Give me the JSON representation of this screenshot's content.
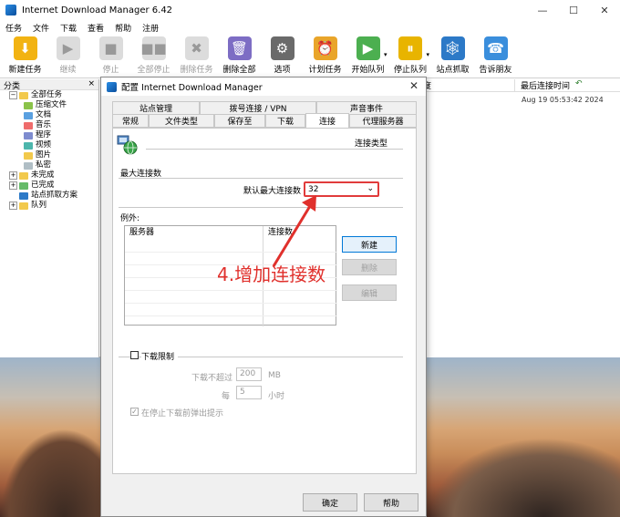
{
  "app": {
    "title": "Internet Download Manager 6.42",
    "menu": [
      "任务",
      "文件",
      "下载",
      "查看",
      "帮助",
      "注册"
    ]
  },
  "toolbar": [
    {
      "label": "新建任务",
      "icon": "add-task-icon",
      "enabled": true,
      "color": "#f2b312"
    },
    {
      "label": "继续",
      "icon": "resume-icon",
      "enabled": false
    },
    {
      "label": "停止",
      "icon": "stop-icon",
      "enabled": false
    },
    {
      "label": "全部停止",
      "icon": "stop-all-icon",
      "enabled": false
    },
    {
      "label": "删除任务",
      "icon": "delete-task-icon",
      "enabled": false
    },
    {
      "label": "删除全部",
      "icon": "delete-all-icon",
      "enabled": true,
      "color": "#7d6dc4"
    },
    {
      "label": "选项",
      "icon": "options-gear-icon",
      "enabled": true,
      "color": "#6a6a6a"
    },
    {
      "label": "计划任务",
      "icon": "scheduler-clock-icon",
      "enabled": true,
      "color": "#e9a52a"
    },
    {
      "label": "开始队列",
      "icon": "start-queue-icon",
      "enabled": true,
      "color": "#4caf50"
    },
    {
      "label": "停止队列",
      "icon": "stop-queue-icon",
      "enabled": true,
      "color": "#e8b400"
    },
    {
      "label": "站点抓取",
      "icon": "site-grabber-icon",
      "enabled": true,
      "color": "#2c79c7"
    },
    {
      "label": "告诉朋友",
      "icon": "tell-friend-icon",
      "enabled": true,
      "color": "#3a8edc"
    }
  ],
  "sidebar": {
    "header": "分类",
    "close": "×",
    "items": [
      {
        "label": "全部任务",
        "level": 0,
        "toggle": "−"
      },
      {
        "label": "压缩文件",
        "level": 1
      },
      {
        "label": "文档",
        "level": 1
      },
      {
        "label": "音乐",
        "level": 1
      },
      {
        "label": "程序",
        "level": 1
      },
      {
        "label": "视频",
        "level": 1
      },
      {
        "label": "图片",
        "level": 1
      },
      {
        "label": "私密",
        "level": 1
      },
      {
        "label": "未完成",
        "level": 0,
        "toggle": "+"
      },
      {
        "label": "已完成",
        "level": 0,
        "toggle": "+"
      },
      {
        "label": "站点抓取方案",
        "level": 0,
        "toggle": ""
      },
      {
        "label": "队列",
        "level": 0,
        "toggle": "+"
      }
    ]
  },
  "list": {
    "col1": "度",
    "col2": "最后连接时间",
    "last_connect": "Aug 19 05:53:42 2024"
  },
  "dialog": {
    "title": "配置 Internet Download Manager",
    "tabs_top": [
      "站点管理",
      "拨号连接 / VPN",
      "声音事件"
    ],
    "tabs_bottom": [
      "常规",
      "文件类型",
      "保存至",
      "下载",
      "连接",
      "代理服务器"
    ],
    "section_title": "连接类型",
    "max_conn_group": "最大连接数",
    "default_max_label": "默认最大连接数",
    "default_max_value": "32",
    "exceptions_label": "例外:",
    "table_headers": [
      "服务器",
      "连接数"
    ],
    "btn_new": "新建",
    "btn_delete": "删除",
    "btn_edit": "编辑",
    "download_limit_label": "下载限制",
    "limit_not_exceed": "下载不超过",
    "limit_value": "200",
    "limit_unit": "MB",
    "every_label": "每",
    "every_value": "5",
    "hours_unit": "小时",
    "warn_checkbox": "在停止下载前弹出提示",
    "ok": "确定",
    "help": "帮助"
  },
  "annotation": {
    "text": "4.增加连接数",
    "color": "#e0302c"
  }
}
